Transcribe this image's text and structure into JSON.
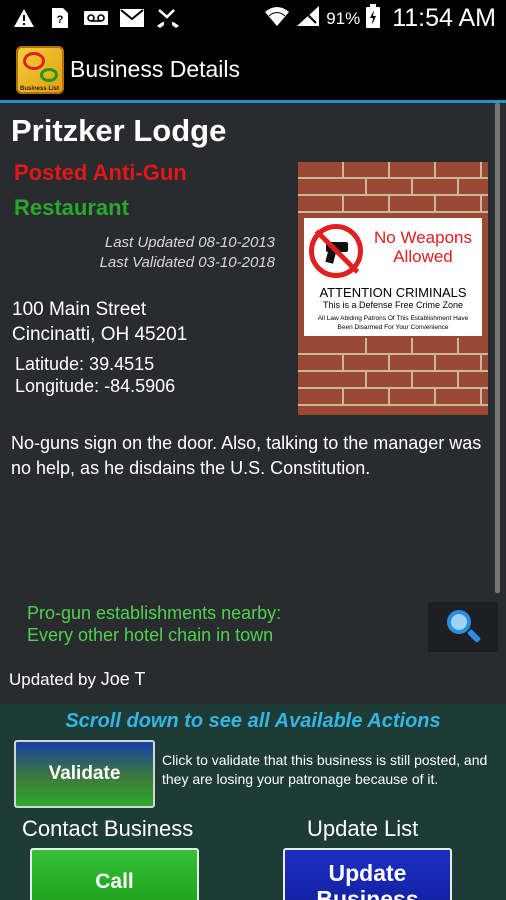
{
  "status_bar": {
    "time": "11:54 AM",
    "battery_percent": "91%",
    "icons": [
      "warning-icon",
      "unknown-sim-icon",
      "voicemail-icon",
      "email-icon",
      "missed-call-icon",
      "wifi-icon",
      "signal-icon",
      "battery-icon"
    ]
  },
  "action_bar": {
    "title": "Business Details",
    "logo_text": "Business List"
  },
  "business": {
    "name": "Pritzker Lodge",
    "posted_status": "Posted Anti-Gun",
    "category": "Restaurant",
    "last_updated": "Last Updated 08-10-2013",
    "last_validated": "Last Validated 03-10-2018",
    "address_line1": "100 Main Street",
    "address_line2": "Cincinatti, OH  45201",
    "latitude": "Latitude:  39.4515",
    "longitude": "Longitude:  -84.5906",
    "comment": "No-guns sign on the door.  Also, talking to the manager was no help, as he disdains the U.S. Constitution."
  },
  "sign_image": {
    "headline": "No Weapons Allowed",
    "line1": "ATTENTION CRIMINALS",
    "line2": "This is a Defense Free Crime Zone",
    "line3": "All Law Abiding Patrons Of This Establishment Have Been Disarmed For Your Convenience"
  },
  "nearby": {
    "line1": "Pro-gun establishments nearby:",
    "line2": "Every other hotel chain in town"
  },
  "updated_by": {
    "prefix": "Updated by",
    "name": "Joe T"
  },
  "actions": {
    "scroll_hint": "Scroll down to see all Available Actions",
    "validate_label": "Validate",
    "validate_description": "Click to validate that this business is still posted, and they are losing your patronage because of it.",
    "contact_label": "Contact Business",
    "update_label": "Update List",
    "call_label": "Call",
    "update_business_label": "Update Business"
  }
}
